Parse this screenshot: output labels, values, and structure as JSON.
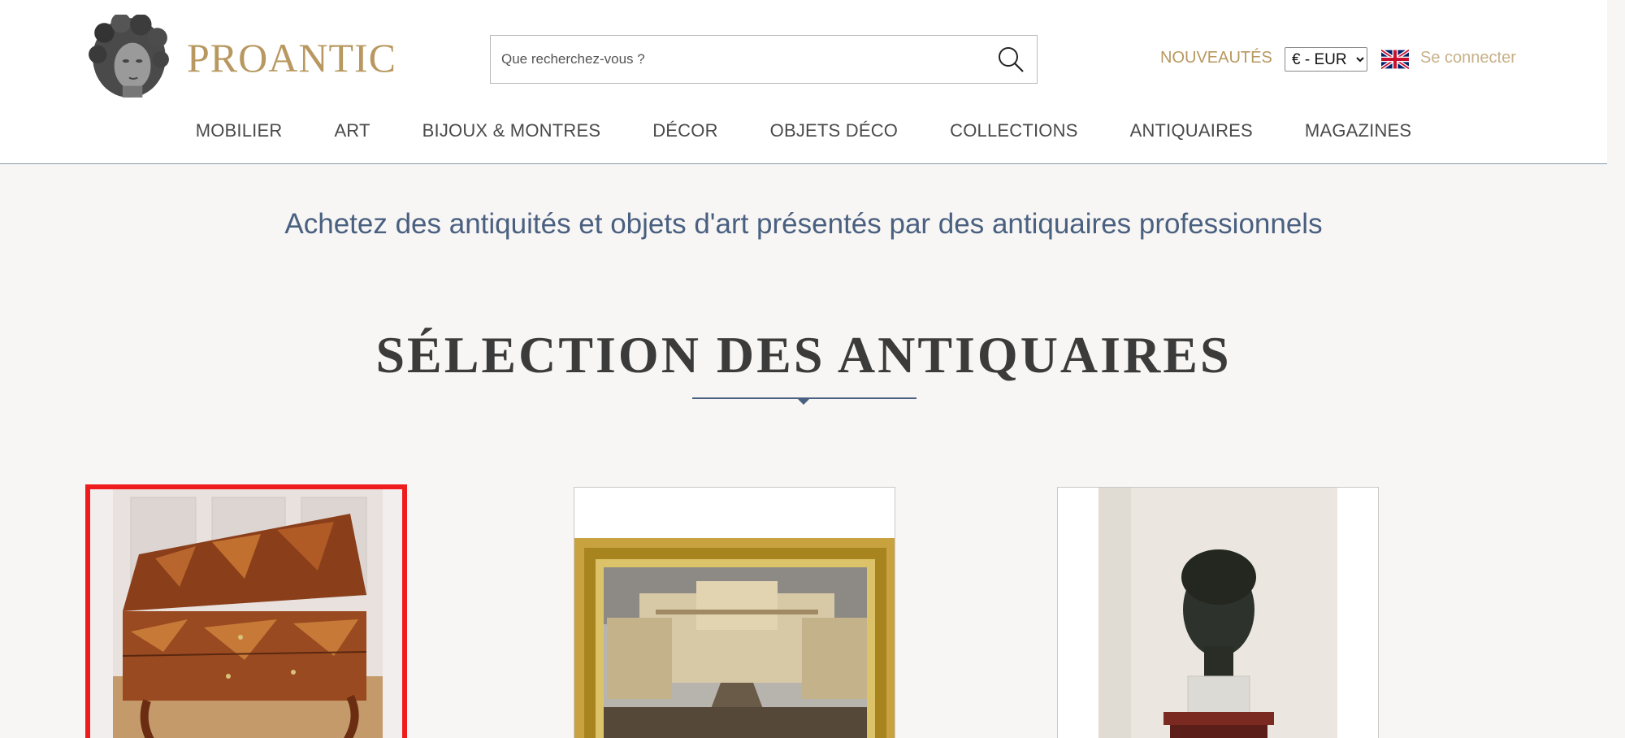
{
  "brand": {
    "name": "PROANTIC"
  },
  "search": {
    "placeholder": "Que recherchez-vous ?"
  },
  "header": {
    "nouveautes": "NOUVEAUTÉS",
    "currency_selected": "€ - EUR",
    "login": "Se connecter",
    "language_icon": "uk-flag-icon"
  },
  "nav": {
    "items": [
      {
        "label": "MOBILIER"
      },
      {
        "label": "ART"
      },
      {
        "label": "BIJOUX & MONTRES"
      },
      {
        "label": "DÉCOR"
      },
      {
        "label": "OBJETS DÉCO"
      },
      {
        "label": "COLLECTIONS"
      },
      {
        "label": "ANTIQUAIRES"
      },
      {
        "label": "MAGAZINES"
      }
    ]
  },
  "main": {
    "tagline": "Achetez des antiquités et objets d'art présentés par des antiquaires professionnels",
    "section_title": "SÉLECTION DES ANTIQUAIRES"
  },
  "colors": {
    "brand_gold": "#b89860",
    "accent_blue": "#4a6080",
    "selection_red": "#ee1c1c",
    "page_bg": "#f7f6f4"
  }
}
